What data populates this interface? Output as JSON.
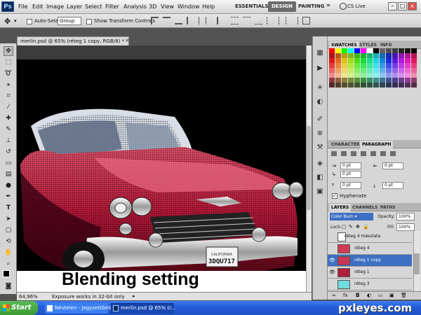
{
  "menubar": {
    "logo": "Ps",
    "items": [
      "File",
      "Edit",
      "Image",
      "Layer",
      "Select",
      "Filter",
      "Analysis",
      "3D",
      "View",
      "Window",
      "Help"
    ],
    "zoom": "65%",
    "workspaces": [
      "ESSENTIALS",
      "DESIGN",
      "PAINTING"
    ],
    "more": "»",
    "cs_live": "CS Live",
    "window_buttons": [
      "–",
      "□",
      "×"
    ]
  },
  "options": {
    "auto_select_label": "Auto-Select:",
    "auto_select_value": "Group",
    "show_transform": "Show Transform Controls"
  },
  "document": {
    "tab_title": "merlin.psd @ 65% (réteg 1 copy, RGB/8) *",
    "caption": "Blending setting",
    "status_zoom": "64,96%",
    "status_text": "Exposure works in 32-bit only"
  },
  "panels": {
    "swatch_tabs": [
      "SWATCHES",
      "STYLES",
      "INFO"
    ],
    "char_tabs": [
      "CHARACTER",
      "PARAGRAPH"
    ],
    "para_fields": [
      "0 pt",
      "0 pt",
      "0 pt",
      "0 pt",
      "0 pt"
    ],
    "hyphenate": "Hyphenate",
    "layer_tabs": [
      "LAYERS",
      "CHANNELS",
      "PATHS"
    ],
    "blend_mode": "Color Burn",
    "opacity_label": "Opacity:",
    "opacity": "100%",
    "lock_label": "Lock:",
    "fill_label": "Fill:",
    "fill": "100%",
    "layers": [
      {
        "name": "réteg 4 másolata",
        "selected": false
      },
      {
        "name": "réteg 4",
        "selected": false
      },
      {
        "name": "réteg 1 copy",
        "selected": true
      },
      {
        "name": "réteg 1",
        "selected": false
      },
      {
        "name": "réteg 3",
        "selected": false
      }
    ]
  },
  "taskbar": {
    "start": "Start",
    "items": [
      "Névtelen - Jegyzettömb",
      "merlin.psd @ 65% (r..."
    ],
    "watermark": "pxleyes.com"
  },
  "colors": {
    "selection_blue": "#3d6fc2",
    "taskbar_blue": "#245edb",
    "car_red": "#b8183a"
  }
}
